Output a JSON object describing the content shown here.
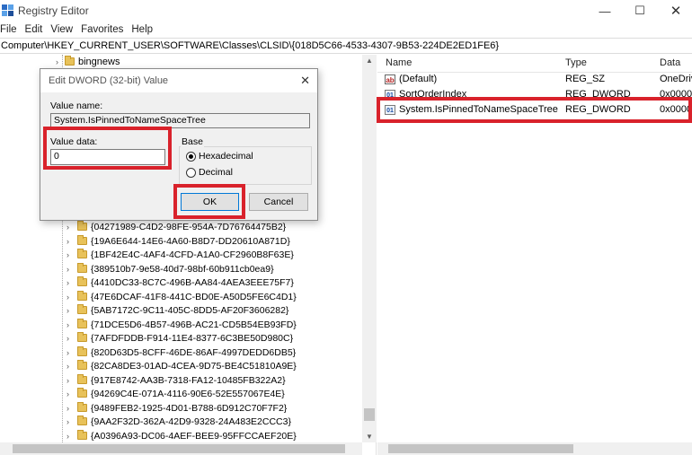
{
  "window": {
    "title": "Registry Editor",
    "minimize_glyph": "—",
    "maximize_glyph": "☐",
    "close_glyph": "✕"
  },
  "menu": [
    "File",
    "Edit",
    "View",
    "Favorites",
    "Help"
  ],
  "address": "Computer\\HKEY_CURRENT_USER\\SOFTWARE\\Classes\\CLSID\\{018D5C66-4533-4307-9B53-224DE2ED1FE6}",
  "tree": {
    "top_item": "bingnews",
    "items": [
      "{04271989-C4D2-98FE-954A-7D76764475B2}",
      "{19A6E644-14E6-4A60-B8D7-DD20610A871D}",
      "{1BF42E4C-4AF4-4CFD-A1A0-CF2960B8F63E}",
      "{389510b7-9e58-40d7-98bf-60b911cb0ea9}",
      "{4410DC33-8C7C-496B-AA84-4AEA3EEE75F7}",
      "{47E6DCAF-41F8-441C-BD0E-A50D5FE6C4D1}",
      "{5AB7172C-9C11-405C-8DD5-AF20F3606282}",
      "{71DCE5D6-4B57-496B-AC21-CD5B54EB93FD}",
      "{7AFDFDDB-F914-11E4-8377-6C3BE50D980C}",
      "{820D63D5-8CFF-46DE-86AF-4997DEDD6DB5}",
      "{82CA8DE3-01AD-4CEA-9D75-BE4C51810A9E}",
      "{917E8742-AA3B-7318-FA12-10485FB322A2}",
      "{94269C4E-071A-4116-90E6-52E557067E4E}",
      "{9489FEB2-1925-4D01-B788-6D912C70F7F2}",
      "{9AA2F32D-362A-42D9-9328-24A483E2CCC3}",
      "{A0396A93-DC06-4AEF-BEE9-95FFCCAEF20E}"
    ]
  },
  "list": {
    "columns": {
      "name": "Name",
      "type": "Type",
      "data": "Data"
    },
    "rows": [
      {
        "icon": "ab",
        "name": "(Default)",
        "type": "REG_SZ",
        "data": "OneDriv"
      },
      {
        "icon": "bin",
        "name": "SortOrderIndex",
        "type": "REG_DWORD",
        "data": "0x00000"
      },
      {
        "icon": "bin",
        "name": "System.IsPinnedToNameSpaceTree",
        "type": "REG_DWORD",
        "data": "0x00000"
      }
    ]
  },
  "dialog": {
    "title": "Edit DWORD (32-bit) Value",
    "value_name_label": "Value name:",
    "value_name": "System.IsPinnedToNameSpaceTree",
    "value_data_label": "Value data:",
    "value_data": "0",
    "base_label": "Base",
    "hex_label": "Hexadecimal",
    "dec_label": "Decimal",
    "base_selected": "Hexadecimal",
    "ok_label": "OK",
    "cancel_label": "Cancel"
  },
  "colors": {
    "highlight": "#d9222b",
    "folder": "#e8c25a"
  }
}
